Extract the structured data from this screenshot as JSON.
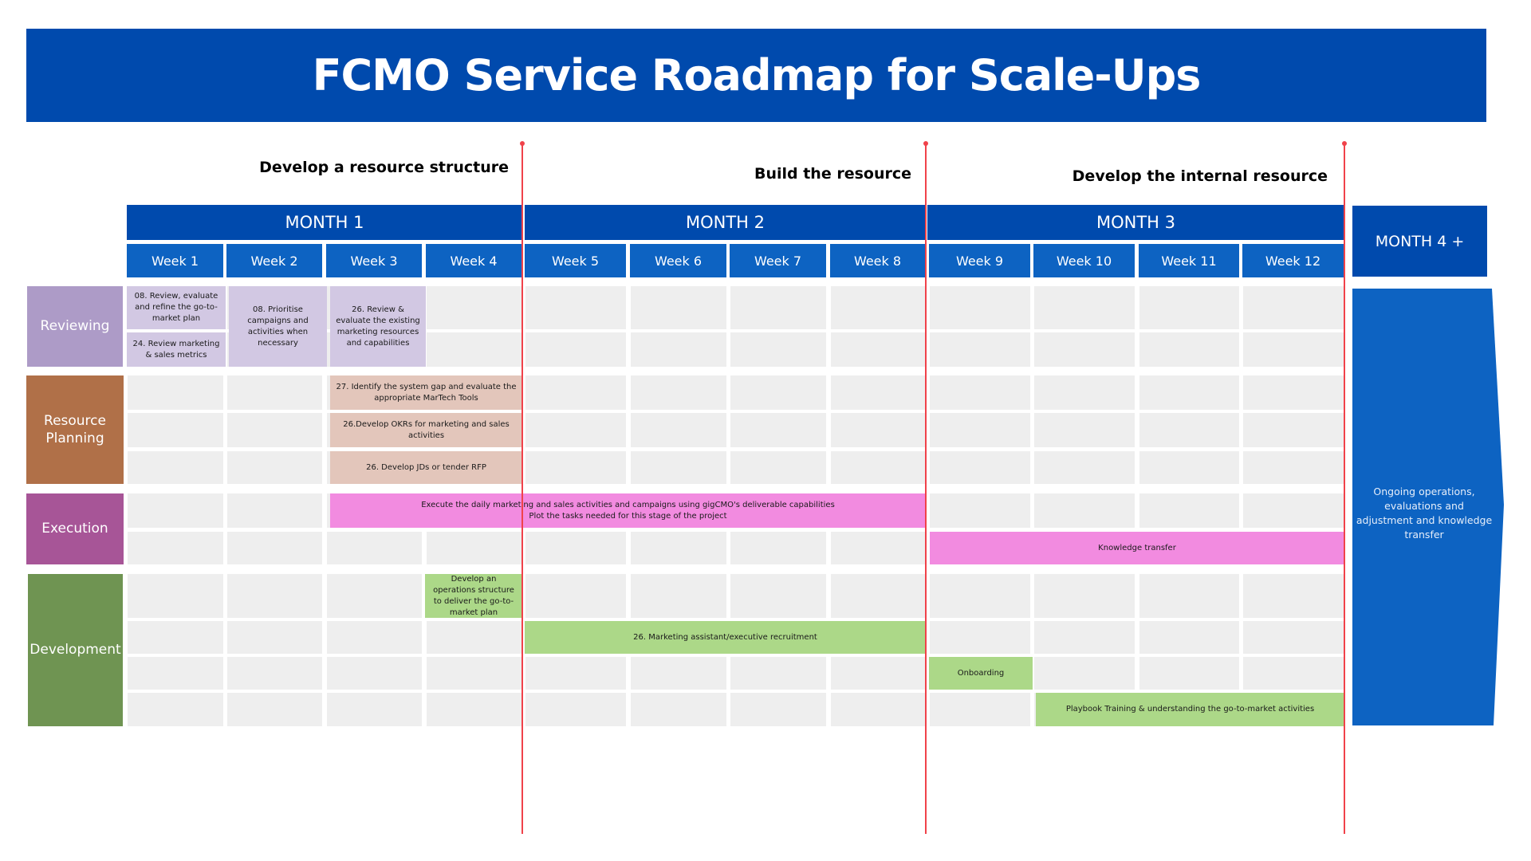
{
  "title": "FCMO Service Roadmap for Scale-Ups",
  "phases": [
    {
      "label": "Develop a resource structure"
    },
    {
      "label": "Build the resource"
    },
    {
      "label": "Develop the internal resource"
    }
  ],
  "months": [
    {
      "label": "MONTH 1"
    },
    {
      "label": "MONTH 2"
    },
    {
      "label": "MONTH 3"
    },
    {
      "label": "MONTH 4 +"
    }
  ],
  "weeks": [
    "Week 1",
    "Week 2",
    "Week 3",
    "Week 4",
    "Week 5",
    "Week 6",
    "Week 7",
    "Week 8",
    "Week 9",
    "Week 10",
    "Week 11",
    "Week 12"
  ],
  "categories": [
    {
      "label": "Reviewing",
      "color": "#ad9bc7"
    },
    {
      "label": "Resource Planning",
      "color": "#b07048"
    },
    {
      "label": "Execution",
      "color": "#a75597"
    },
    {
      "label": "Development",
      "color": "#6f9452"
    }
  ],
  "tasks": {
    "review_1": "08. Review, evaluate and refine the go-to-market plan",
    "review_2": "24. Review marketing & sales metrics",
    "review_3": "08. Prioritise campaigns and activities when necessary",
    "review_4": "26. Review & evaluate the existing marketing resources and capabilities",
    "resource_1": "27. Identify the system gap and evaluate the appropriate MarTech Tools",
    "resource_2": "26.Develop OKRs for marketing and sales activities",
    "resource_3": "26. Develop JDs or tender RFP",
    "exec_1_line1": "Execute the daily marketing and sales activities and campaigns using gigCMO's deliverable capabilities",
    "exec_1_line2": "Plot the tasks needed for this stage of the project",
    "exec_2": "Knowledge transfer",
    "dev_1": "Develop an operations structure to deliver the go-to-market plan",
    "dev_2": "26. Marketing assistant/executive recruitment",
    "dev_3": "Onboarding",
    "dev_4": "Playbook Training & understanding the go-to-market activities"
  },
  "ongoing": "Ongoing operations, evaluations and adjustment and knowledge transfer",
  "colors": {
    "header_blue": "#004aad",
    "week_blue": "#0d63c2",
    "milestone_red": "#f0424a",
    "empty_cell": "#eeeeee"
  }
}
